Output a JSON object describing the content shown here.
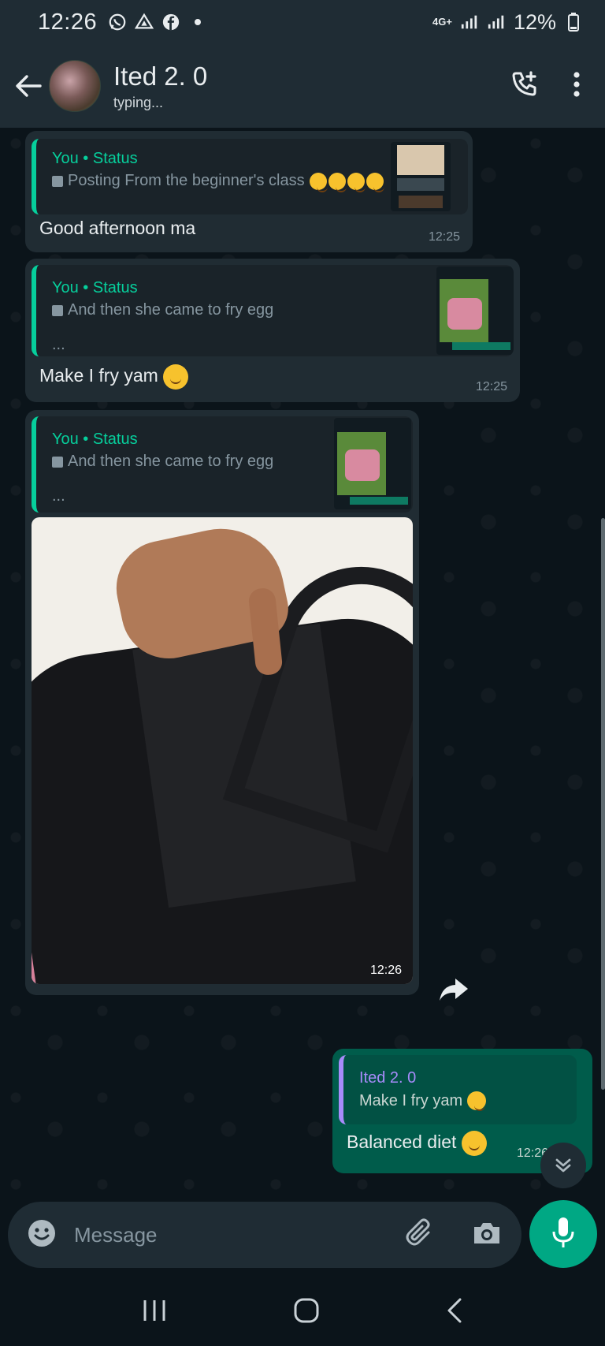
{
  "status_bar": {
    "time": "12:26",
    "network": "4G+",
    "battery": "12%",
    "icons": [
      "whatsapp-icon",
      "drive-icon",
      "facebook-icon",
      "dot-icon",
      "signal-icon",
      "battery-icon"
    ]
  },
  "header": {
    "contact_name": "Ited 2. 0",
    "contact_status": "typing...",
    "icons": [
      "back-arrow-icon",
      "add-call-icon",
      "more-vert-icon"
    ]
  },
  "messages": [
    {
      "quote_title": "You • Status",
      "quote_text": "Posting From the beginner's class",
      "text": "Good afternoon ma",
      "time": "12:25"
    },
    {
      "quote_title": "You • Status",
      "quote_text": "And then she came to fry egg",
      "quote_more": "...",
      "text": "Make I fry yam",
      "time": "12:25"
    },
    {
      "quote_title": "You • Status",
      "quote_text": "And then she came to fry egg",
      "quote_more": "...",
      "time": "12:26"
    }
  ],
  "sent_message": {
    "quote_title": "Ited 2. 0",
    "quote_text": "Make I fry yam",
    "text": "Balanced diet",
    "time": "12:26"
  },
  "input": {
    "placeholder": "Message",
    "icons": [
      "emoji-icon",
      "attach-icon",
      "camera-icon",
      "mic-icon"
    ]
  },
  "colors": {
    "background": "#0b141a",
    "header": "#1f2c34",
    "incoming_bubble": "#202c33",
    "outgoing_bubble": "#005c4b",
    "accent": "#00a884",
    "status_quote": "#06cf9c",
    "contact_quote": "#a78bfa"
  }
}
